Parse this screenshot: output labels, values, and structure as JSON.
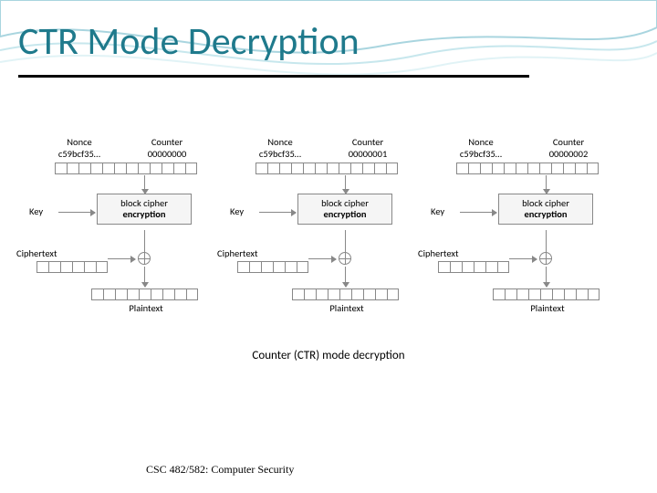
{
  "title": "CTR Mode Decryption",
  "footer": "CSC 482/582: Computer Security",
  "diagram": {
    "labels": {
      "nonce": "Nonce",
      "counter": "Counter",
      "key": "Key",
      "ciphertext": "Ciphertext",
      "plaintext": "Plaintext",
      "block_top": "block cipher",
      "block_bottom": "encryption"
    },
    "nonce_value": "c59bcf35…",
    "blocks": [
      {
        "counter": "00000000"
      },
      {
        "counter": "00000001"
      },
      {
        "counter": "00000002"
      }
    ],
    "caption": "Counter (CTR) mode decryption"
  }
}
